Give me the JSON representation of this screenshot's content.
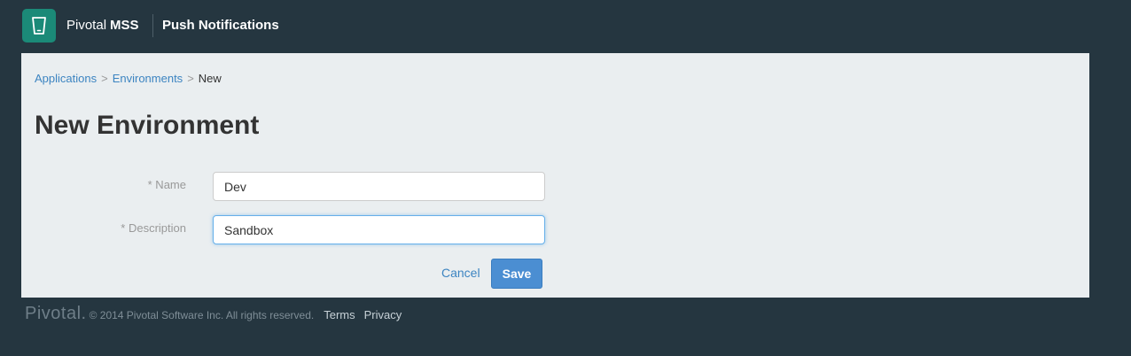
{
  "header": {
    "brand_light": "Pivotal",
    "brand_bold": "MSS",
    "product": "Push Notifications",
    "logo_icon": "phone-icon",
    "logo_color": "#1b8a78"
  },
  "breadcrumb": {
    "items": [
      "Applications",
      "Environments",
      "New"
    ],
    "separator": ">"
  },
  "page": {
    "title": "New Environment"
  },
  "form": {
    "name_label": "* Name",
    "name_value": "Dev",
    "description_label": "* Description",
    "description_value": "Sandbox",
    "cancel_label": "Cancel",
    "save_label": "Save"
  },
  "footer": {
    "logo": "Pivotal.",
    "copyright": "© 2014 Pivotal Software Inc. All rights reserved.",
    "links": [
      "Terms",
      "Privacy"
    ]
  },
  "colors": {
    "background": "#253640",
    "panel": "#eaeef0",
    "link": "#3c84c1",
    "primary": "#4b8ed2"
  }
}
